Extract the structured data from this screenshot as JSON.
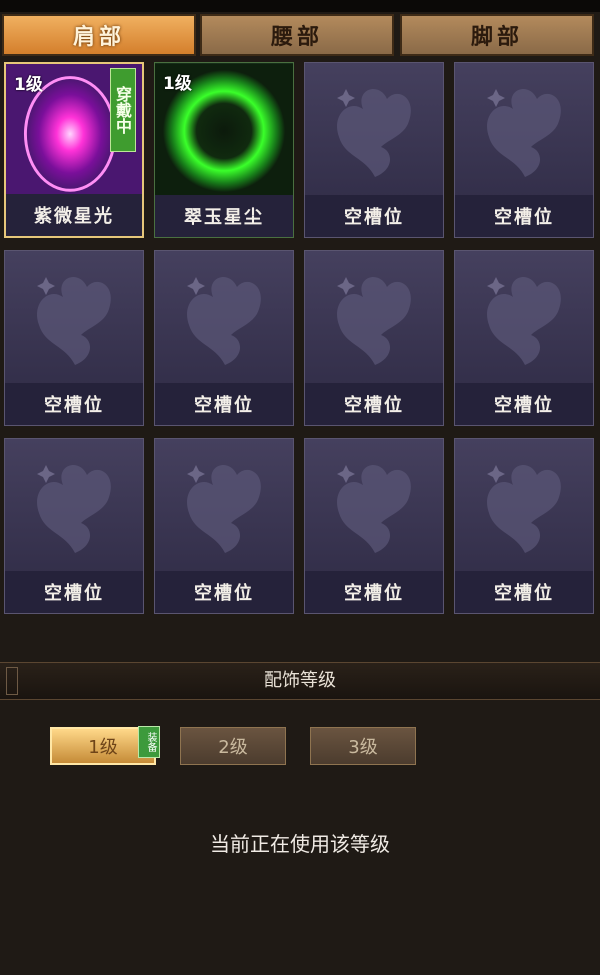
{
  "tabs": [
    {
      "label": "肩部",
      "active": true
    },
    {
      "label": "腰部",
      "active": false
    },
    {
      "label": "脚部",
      "active": false
    }
  ],
  "slots": [
    {
      "name": "紫微星光",
      "level": "1级",
      "status": "穿戴中",
      "icon": "purple-orb-icon"
    },
    {
      "name": "翠玉星尘",
      "level": "1级",
      "icon": "green-orb-icon"
    },
    {
      "name": "空槽位",
      "icon": "butterfly-icon"
    },
    {
      "name": "空槽位",
      "icon": "butterfly-icon"
    },
    {
      "name": "空槽位",
      "icon": "butterfly-icon"
    },
    {
      "name": "空槽位",
      "icon": "butterfly-icon"
    },
    {
      "name": "空槽位",
      "icon": "butterfly-icon"
    },
    {
      "name": "空槽位",
      "icon": "butterfly-icon"
    },
    {
      "name": "空槽位",
      "icon": "butterfly-icon"
    },
    {
      "name": "空槽位",
      "icon": "butterfly-icon"
    },
    {
      "name": "空槽位",
      "icon": "butterfly-icon"
    },
    {
      "name": "空槽位",
      "icon": "butterfly-icon"
    }
  ],
  "section_title": "配饰等级",
  "levels": [
    {
      "label": "1级",
      "active": true,
      "badge": "装备"
    },
    {
      "label": "2级",
      "active": false
    },
    {
      "label": "3级",
      "active": false
    }
  ],
  "status_text": "当前正在使用该等级",
  "colors": {
    "tab_active": "#d47f2c",
    "slot_bg": "#2e2a44",
    "equip_green": "#3f9c2f"
  }
}
